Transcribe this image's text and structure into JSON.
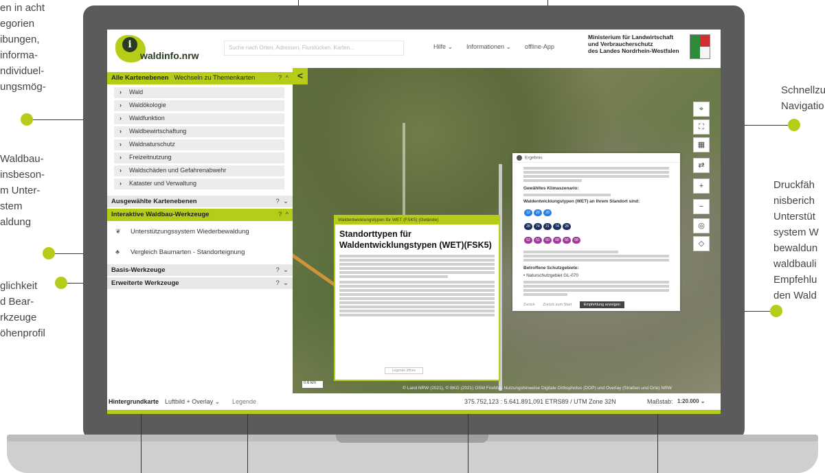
{
  "annotations": {
    "top_left": [
      "en in acht",
      "egorien",
      "ibungen,",
      "informa-",
      "ndividuel-",
      "ungsmög-"
    ],
    "mid_left": [
      "Waldbau-",
      "insbeson-",
      "m Unter-",
      "stem",
      "aldung"
    ],
    "low_left": [
      "glichkeit",
      "d Bear-",
      "rkzeuge",
      "öhenprofil"
    ],
    "top_right": [
      "Schnellzu",
      "Navigatio"
    ],
    "mid_right": [
      "Druckfäh",
      "nisberich",
      "Unterstüt",
      "system W",
      "bewaldun",
      "waldbauli",
      "Empfehlu",
      "den Wald"
    ]
  },
  "app": {
    "logo_text": "waldinfo.nrw",
    "logo_letter": "i",
    "search_placeholder": "Suche nach Orten, Adressen, Flurstücken, Karten...",
    "nav": [
      "Hilfe ⌄",
      "Informationen ⌄",
      "offline-App"
    ],
    "ministry": [
      "Ministerium für Landwirtschaft",
      "und Verbraucherschutz",
      "des Landes Nordrhein-Westfalen"
    ]
  },
  "sidebar": {
    "all_layers": {
      "label": "Alle Kartenebenen",
      "switch": "Wechseln zu Themenkarten",
      "help": "?",
      "toggle": "^"
    },
    "items": [
      "Wald",
      "Waldökologie",
      "Waldfunktion",
      "Waldbewirtschaftung",
      "Waldnaturschutz",
      "Freizeitnutzung",
      "Waldschäden und Gefahrenabwehr",
      "Kataster und Verwaltung"
    ],
    "selected_layers": {
      "label": "Ausgewählte Kartenebenen",
      "help": "?",
      "toggle": "⌄"
    },
    "interactive": {
      "label": "Interaktive Waldbau-Werkzeuge",
      "help": "?",
      "toggle": "^"
    },
    "tools": [
      "Unterstützungssystem Wiederbewaldung",
      "Vergleich Baumarten - Standorteignung"
    ],
    "basis": {
      "label": "Basis-Werkzeuge",
      "help": "?",
      "toggle": "⌄"
    },
    "extended": {
      "label": "Erweiterte Werkzeuge",
      "help": "?",
      "toggle": "⌄"
    },
    "collapse": "<"
  },
  "map": {
    "controls": [
      "⌖",
      "⛶",
      "▦",
      "⇄",
      "+",
      "−",
      "◎",
      "◇"
    ],
    "scale_label": "0.6 km",
    "attribution": "© Land NRW (2021), © BKG (2021)  OSM FireMap Nutzungshinweise   Digitale Orthophotos (DOP) und Overlay (Straßen und Orte) NRW"
  },
  "dialog_info": {
    "bar": "Waldentwicklungstypen für WET (FSK5) (Gelände)",
    "title": "Standorttypen für Waldentwicklungstypen (WET)(FSK5)",
    "button": "Legende öffnen"
  },
  "dialog_result": {
    "header": "Ergebnis",
    "klimaszenario": "Gewähltes Klimaszenario:",
    "wet_heading": "Waldentwicklungstypen (WET) an Ihrem Standort sind:",
    "pills_row1": [
      "12",
      "20",
      "20"
    ],
    "pills_row2": [
      "28",
      "74",
      "21",
      "74",
      "28"
    ],
    "pills_row3": [
      "52",
      "51",
      "60",
      "68",
      "56",
      "58"
    ],
    "schutz_heading": "Betroffene Schutzgebiete:",
    "schutz_item": "• Naturschutzgebiet  GL-070",
    "footer": [
      "Zurück",
      "Zurück zum Start",
      "Empfehlung anzeigen"
    ],
    "colors": {
      "light_blue": "#2a7de1",
      "dark_blue": "#1d2f5f",
      "purple": "#a0399a"
    }
  },
  "footer": {
    "background_label": "Hintergrundkarte",
    "background_value": "Luftbild + Overlay ⌄",
    "legend": "Legende",
    "coordinates": "375.752,123 : 5.641.891,091  ETRS89 / UTM Zone 32N",
    "scale_label": "Maßstab:",
    "scale_value": "1:20.000  ⌄"
  },
  "colors": {
    "accent": "#b5cc18",
    "laptop": "#5b5b5b"
  }
}
